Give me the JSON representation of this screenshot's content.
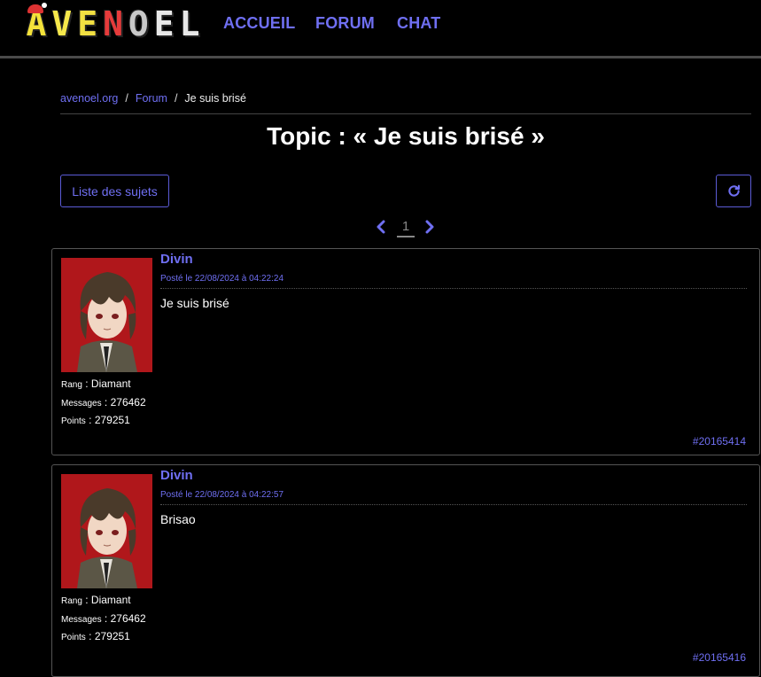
{
  "brand": {
    "logo_text": "AVENOEL",
    "letters": [
      "A",
      "V",
      "E",
      "N",
      "O",
      "E",
      "L"
    ],
    "letter_colors": [
      "#f4e23a",
      "#f6e84b",
      "#f2e042",
      "#e63b3b",
      "#c8c8c8",
      "#e8e8e8",
      "#e8e8e8"
    ]
  },
  "nav": {
    "accueil": "ACCUEIL",
    "forum": "FORUM",
    "chat": "CHAT"
  },
  "breadcrumb": {
    "home": "avenoel.org",
    "forum": "Forum",
    "current": "Je suis brisé",
    "separator": "/"
  },
  "page": {
    "title": "Topic : « Je suis brisé »"
  },
  "toolbar": {
    "topics_list_label": "Liste des sujets",
    "refresh_icon": "refresh-icon"
  },
  "pagination": {
    "current_page": "1",
    "prev_icon": "chevron-left-icon",
    "next_icon": "chevron-right-icon"
  },
  "labels": {
    "rank": "Rang",
    "messages": "Messages",
    "points": "Points"
  },
  "posts": [
    {
      "author": "Divin",
      "date": "Posté le 22/08/2024 à 04:22:24",
      "body": "Je suis brisé",
      "rank": "Diamant",
      "messages": "276462",
      "points": "279251",
      "id": "#20165414"
    },
    {
      "author": "Divin",
      "date": "Posté le 22/08/2024 à 04:22:57",
      "body": "Brisao",
      "rank": "Diamant",
      "messages": "276462",
      "points": "279251",
      "id": "#20165416"
    }
  ],
  "colors": {
    "accent": "#6f6ff2",
    "background": "#000000",
    "avatar_bg": "#b0171b"
  }
}
